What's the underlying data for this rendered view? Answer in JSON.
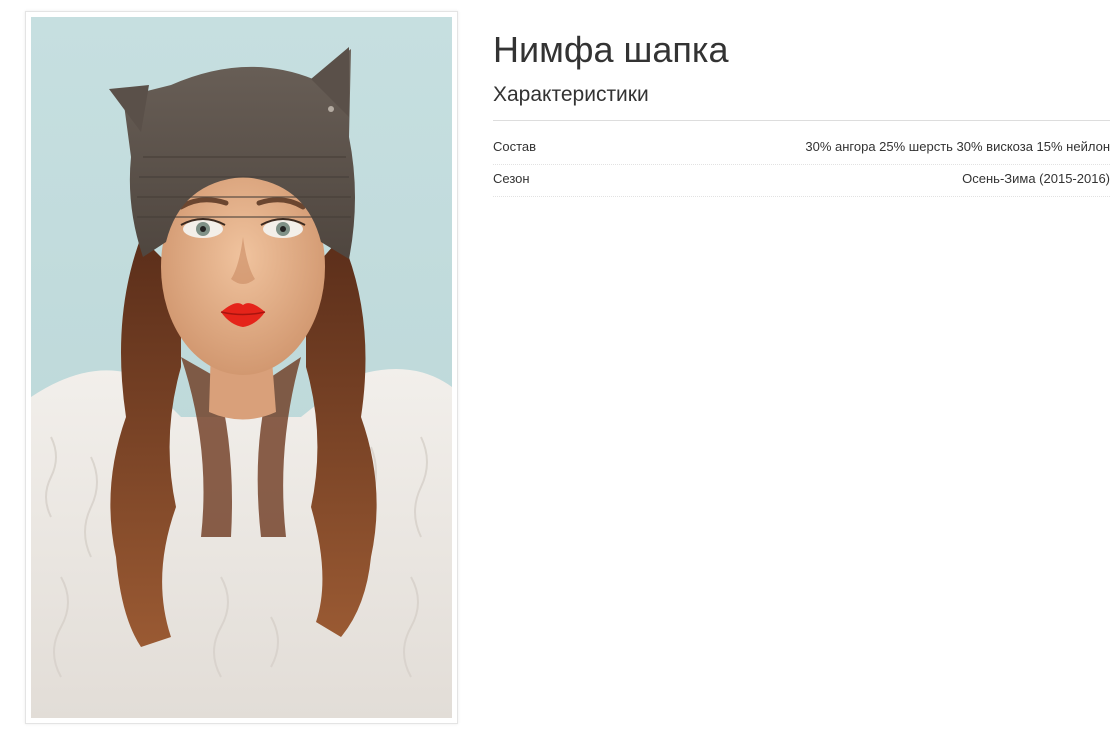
{
  "product": {
    "title": "Нимфа шапка",
    "specs_heading": "Характеристики",
    "specs": [
      {
        "name": "Состав",
        "value": "30% ангора 25% шерсть 30% вискоза 15% нейлон"
      },
      {
        "name": "Сезон",
        "value": "Осень-Зима (2015-2016)"
      }
    ]
  },
  "photo": {
    "subject": "model-wearing-cat-ear-hat",
    "colors": {
      "background": "#c3dcdc",
      "hat": "#5e544d",
      "hair": "#7a4227",
      "fur": "#ece7e2",
      "lips": "#e5241a",
      "skin": "#e7b48f"
    }
  }
}
